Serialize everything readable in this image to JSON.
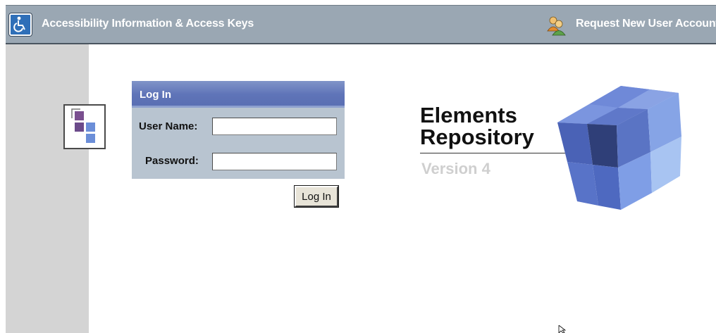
{
  "header": {
    "accessibility_link": "Accessibility Information & Access Keys",
    "request_account_link": "Request New User Account",
    "accessibility_icon": "wheelchair-icon",
    "user_icon": "add-user-icon"
  },
  "login": {
    "title": "Log In",
    "username_label": "User Name:",
    "username_value": "",
    "password_label": "Password:",
    "password_value": "",
    "submit_label": "Log In"
  },
  "branding": {
    "line1": "Elements",
    "line2": "Repository",
    "version": "Version 4",
    "logo_icon": "cube-logo-icon"
  },
  "colors": {
    "header_bar": "#9aa7b3",
    "login_header": "#5f74b8",
    "login_panel": "#b8c4d0",
    "side_panel": "#d4d4d4",
    "cube_blue": "#5a74c4"
  }
}
